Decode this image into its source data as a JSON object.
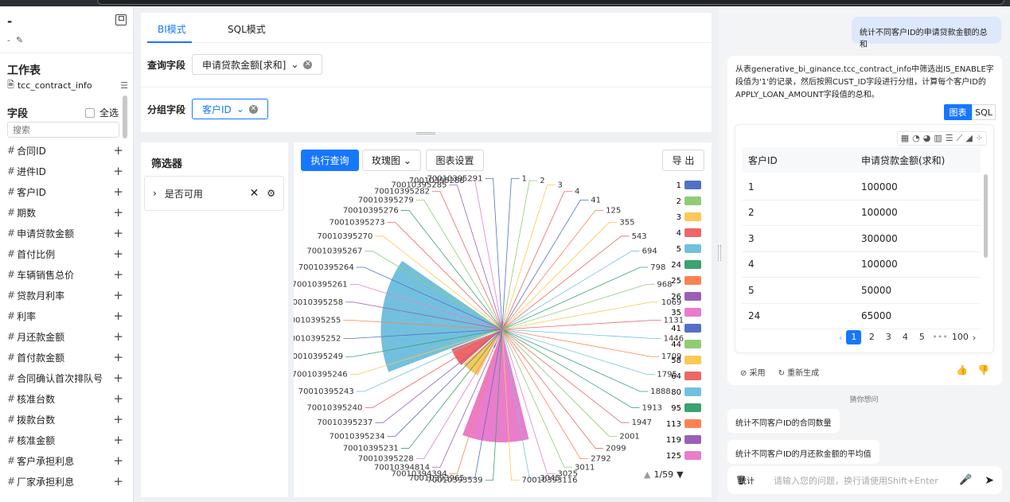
{
  "window": {
    "title": "-",
    "subtitle": "-"
  },
  "sidebar": {
    "worksheet_label": "工作表",
    "table_name": "tcc_contract_info",
    "fields_label": "字段",
    "select_all": "全选",
    "search_placeholder": "搜索",
    "fields": [
      "合同ID",
      "进件ID",
      "客户ID",
      "期数",
      "申请贷款金额",
      "首付比例",
      "车辆销售总价",
      "贷款月利率",
      "利率",
      "月还款金额",
      "首付款金额",
      "合同确认首次排队号",
      "核准台数",
      "拨款台数",
      "核准金额",
      "客户承担利息",
      "厂家承担利息"
    ]
  },
  "tabs": [
    {
      "label": "BI模式",
      "active": true
    },
    {
      "label": "SQL模式",
      "active": false
    }
  ],
  "query": {
    "query_field_label": "查询字段",
    "query_field_value": "申请贷款金额[求和]",
    "group_field_label": "分组字段",
    "group_field_value": "客户ID"
  },
  "filter_panel": {
    "title": "筛选器",
    "item_label": "是否可用"
  },
  "chart_toolbar": {
    "run_label": "执行查询",
    "chart_type_label": "玫瑰图",
    "settings_label": "图表设置",
    "export_label": "导 出",
    "legend_page": "1/59"
  },
  "chart_data": {
    "type": "pie",
    "variant": "rose",
    "slices": [
      {
        "label": "1",
        "value": 100000,
        "color": "#5470c6"
      },
      {
        "label": "2",
        "value": 100000,
        "color": "#91cc75"
      },
      {
        "label": "3",
        "value": 300000,
        "color": "#fac858"
      },
      {
        "label": "4",
        "value": 100000,
        "color": "#ee6666"
      },
      {
        "label": "41",
        "value": 0,
        "color": "#5470c6"
      },
      {
        "label": "125",
        "value": 0,
        "color": "#fc8452"
      },
      {
        "label": "355",
        "value": 0,
        "color": "#fac858"
      },
      {
        "label": "543",
        "value": 0,
        "color": "#ee6666"
      },
      {
        "label": "694",
        "value": 0,
        "color": "#73c0de"
      },
      {
        "label": "798",
        "value": 0,
        "color": "#3ba272"
      },
      {
        "label": "968",
        "value": 0,
        "color": "#91cc75"
      },
      {
        "label": "1069",
        "value": 0,
        "color": "#fac858"
      },
      {
        "label": "1131",
        "value": 0,
        "color": "#ee6666"
      },
      {
        "label": "1446",
        "value": 0,
        "color": "#73c0de"
      },
      {
        "label": "1709",
        "value": 0,
        "color": "#fc8452"
      },
      {
        "label": "1795",
        "value": 0,
        "color": "#73c0de"
      },
      {
        "label": "1888",
        "value": 0,
        "color": "#3ba272"
      },
      {
        "label": "1913",
        "value": 0,
        "color": "#3ba272"
      },
      {
        "label": "1947",
        "value": 0,
        "color": "#ee6666"
      },
      {
        "label": "2001",
        "value": 0,
        "color": "#91cc75"
      },
      {
        "label": "2099",
        "value": 0,
        "color": "#ee6666"
      },
      {
        "label": "2792",
        "value": 0,
        "color": "#fc8452"
      },
      {
        "label": "3011",
        "value": 0,
        "color": "#91cc75"
      },
      {
        "label": "3025",
        "value": 0,
        "color": "#ea7ccc"
      },
      {
        "label": "3045",
        "value": 0,
        "color": "#73c0de"
      },
      {
        "label": "70010393116",
        "value": 0,
        "color": "#fac858"
      },
      {
        "label": "70010393539",
        "value": 0,
        "color": "#3ba272"
      },
      {
        "label": "70010393965",
        "value": 0,
        "color": "#5470c6"
      },
      {
        "label": "70010394394",
        "value": 0,
        "color": "#fc8452"
      },
      {
        "label": "70010394814",
        "value": 0,
        "color": "#9a60b4"
      },
      {
        "label": "70010395228",
        "value": 0,
        "color": "#ea7ccc"
      },
      {
        "label": "70010395231",
        "value": 0,
        "color": "#3ba272"
      },
      {
        "label": "70010395234",
        "value": 0,
        "color": "#5470c6"
      },
      {
        "label": "70010395237",
        "value": 0,
        "color": "#9a60b4"
      },
      {
        "label": "70010395240",
        "value": 0,
        "color": "#ee6666"
      },
      {
        "label": "70010395243",
        "value": 0,
        "color": "#73c0de"
      },
      {
        "label": "70010395246",
        "value": 0,
        "color": "#fac858"
      },
      {
        "label": "70010395249",
        "value": 0,
        "color": "#3ba272"
      },
      {
        "label": "70010395252",
        "value": 0,
        "color": "#5470c6"
      },
      {
        "label": "70010395255",
        "value": 0,
        "color": "#fc8452"
      },
      {
        "label": "70010395258",
        "value": 0,
        "color": "#9a60b4"
      },
      {
        "label": "70010395261",
        "value": 0,
        "color": "#ea7ccc"
      },
      {
        "label": "70010395264",
        "value": 0,
        "color": "#5470c6"
      },
      {
        "label": "70010395267",
        "value": 0,
        "color": "#91cc75"
      },
      {
        "label": "70010395270",
        "value": 0,
        "color": "#fac858"
      },
      {
        "label": "70010395273",
        "value": 0,
        "color": "#ee6666"
      },
      {
        "label": "70010395276",
        "value": 0,
        "color": "#3ba272"
      },
      {
        "label": "70010395279",
        "value": 0,
        "color": "#91cc75"
      },
      {
        "label": "70010395282",
        "value": 0,
        "color": "#ee6666"
      },
      {
        "label": "70010395285",
        "value": 0,
        "color": "#9a60b4"
      },
      {
        "label": "70010395288",
        "value": 0,
        "color": "#ea7ccc"
      },
      {
        "label": "70010395291",
        "value": 0,
        "color": "#5470c6"
      }
    ],
    "rose_sectors": [
      {
        "start_label_index": 24,
        "end_label_index": 29,
        "value": 9.5,
        "color": "#ea7ccc"
      },
      {
        "start_label_index": 29,
        "end_label_index": 30,
        "value": 1.7,
        "color": "#9a60b4"
      },
      {
        "start_label_index": 22,
        "end_label_index": 23,
        "value": 1.2,
        "color": "#ee6666"
      },
      {
        "start_label_index": 30,
        "end_label_index": 33,
        "value": 4.4,
        "color": "#fac858"
      },
      {
        "start_label_index": 33,
        "end_label_index": 36,
        "value": 4.6,
        "color": "#ee6666"
      },
      {
        "start_label_index": 36,
        "end_label_index": 44,
        "value": 10.2,
        "color": "#73c0de"
      }
    ],
    "legend": [
      {
        "label": "1",
        "color": "#5470c6"
      },
      {
        "label": "2",
        "color": "#91cc75"
      },
      {
        "label": "3",
        "color": "#fac858"
      },
      {
        "label": "4",
        "color": "#ee6666"
      },
      {
        "label": "5",
        "color": "#73c0de"
      },
      {
        "label": "24",
        "color": "#3ba272"
      },
      {
        "label": "25",
        "color": "#fc8452"
      },
      {
        "label": "26",
        "color": "#9a60b4"
      },
      {
        "label": "35",
        "color": "#ea7ccc"
      },
      {
        "label": "41",
        "color": "#5470c6"
      },
      {
        "label": "44",
        "color": "#91cc75"
      },
      {
        "label": "58",
        "color": "#fac858"
      },
      {
        "label": "64",
        "color": "#ee6666"
      },
      {
        "label": "80",
        "color": "#73c0de"
      },
      {
        "label": "95",
        "color": "#3ba272"
      },
      {
        "label": "113",
        "color": "#fc8452"
      },
      {
        "label": "119",
        "color": "#9a60b4"
      },
      {
        "label": "125",
        "color": "#ea7ccc"
      }
    ],
    "legend_placement": "right"
  },
  "chat": {
    "user_message": "统计不同客户ID的申请贷款金额的总和",
    "bot_message": "从表generative_bi_ginance.tcc_contract_info中筛选出IS_ENABLE字段值为'1'的记录，然后按照CUST_ID字段进行分组，计算每个客户ID的APPLY_LOAN_AMOUNT字段值的总和。",
    "view_chart": "图表",
    "view_sql": "SQL",
    "table": {
      "headers": [
        "客户ID",
        "申请贷款金额(求和)"
      ],
      "rows": [
        [
          "1",
          "100000"
        ],
        [
          "2",
          "100000"
        ],
        [
          "3",
          "300000"
        ],
        [
          "4",
          "100000"
        ],
        [
          "5",
          "50000"
        ],
        [
          "24",
          "65000"
        ]
      ]
    },
    "pagination": {
      "pages": [
        "1",
        "2",
        "3",
        "4",
        "5"
      ],
      "ellipsis": "•••",
      "last": "100"
    },
    "adopt": "采用",
    "regenerate": "重新生成",
    "guess_title": "猜你想问",
    "suggestions": [
      "统计不同客户ID的合同数量",
      "统计不同客户ID的月还款金额的平均值"
    ],
    "input_prefix": "统计",
    "input_placeholder": "请输入您的问题，换行请使用Shift+Enter"
  }
}
